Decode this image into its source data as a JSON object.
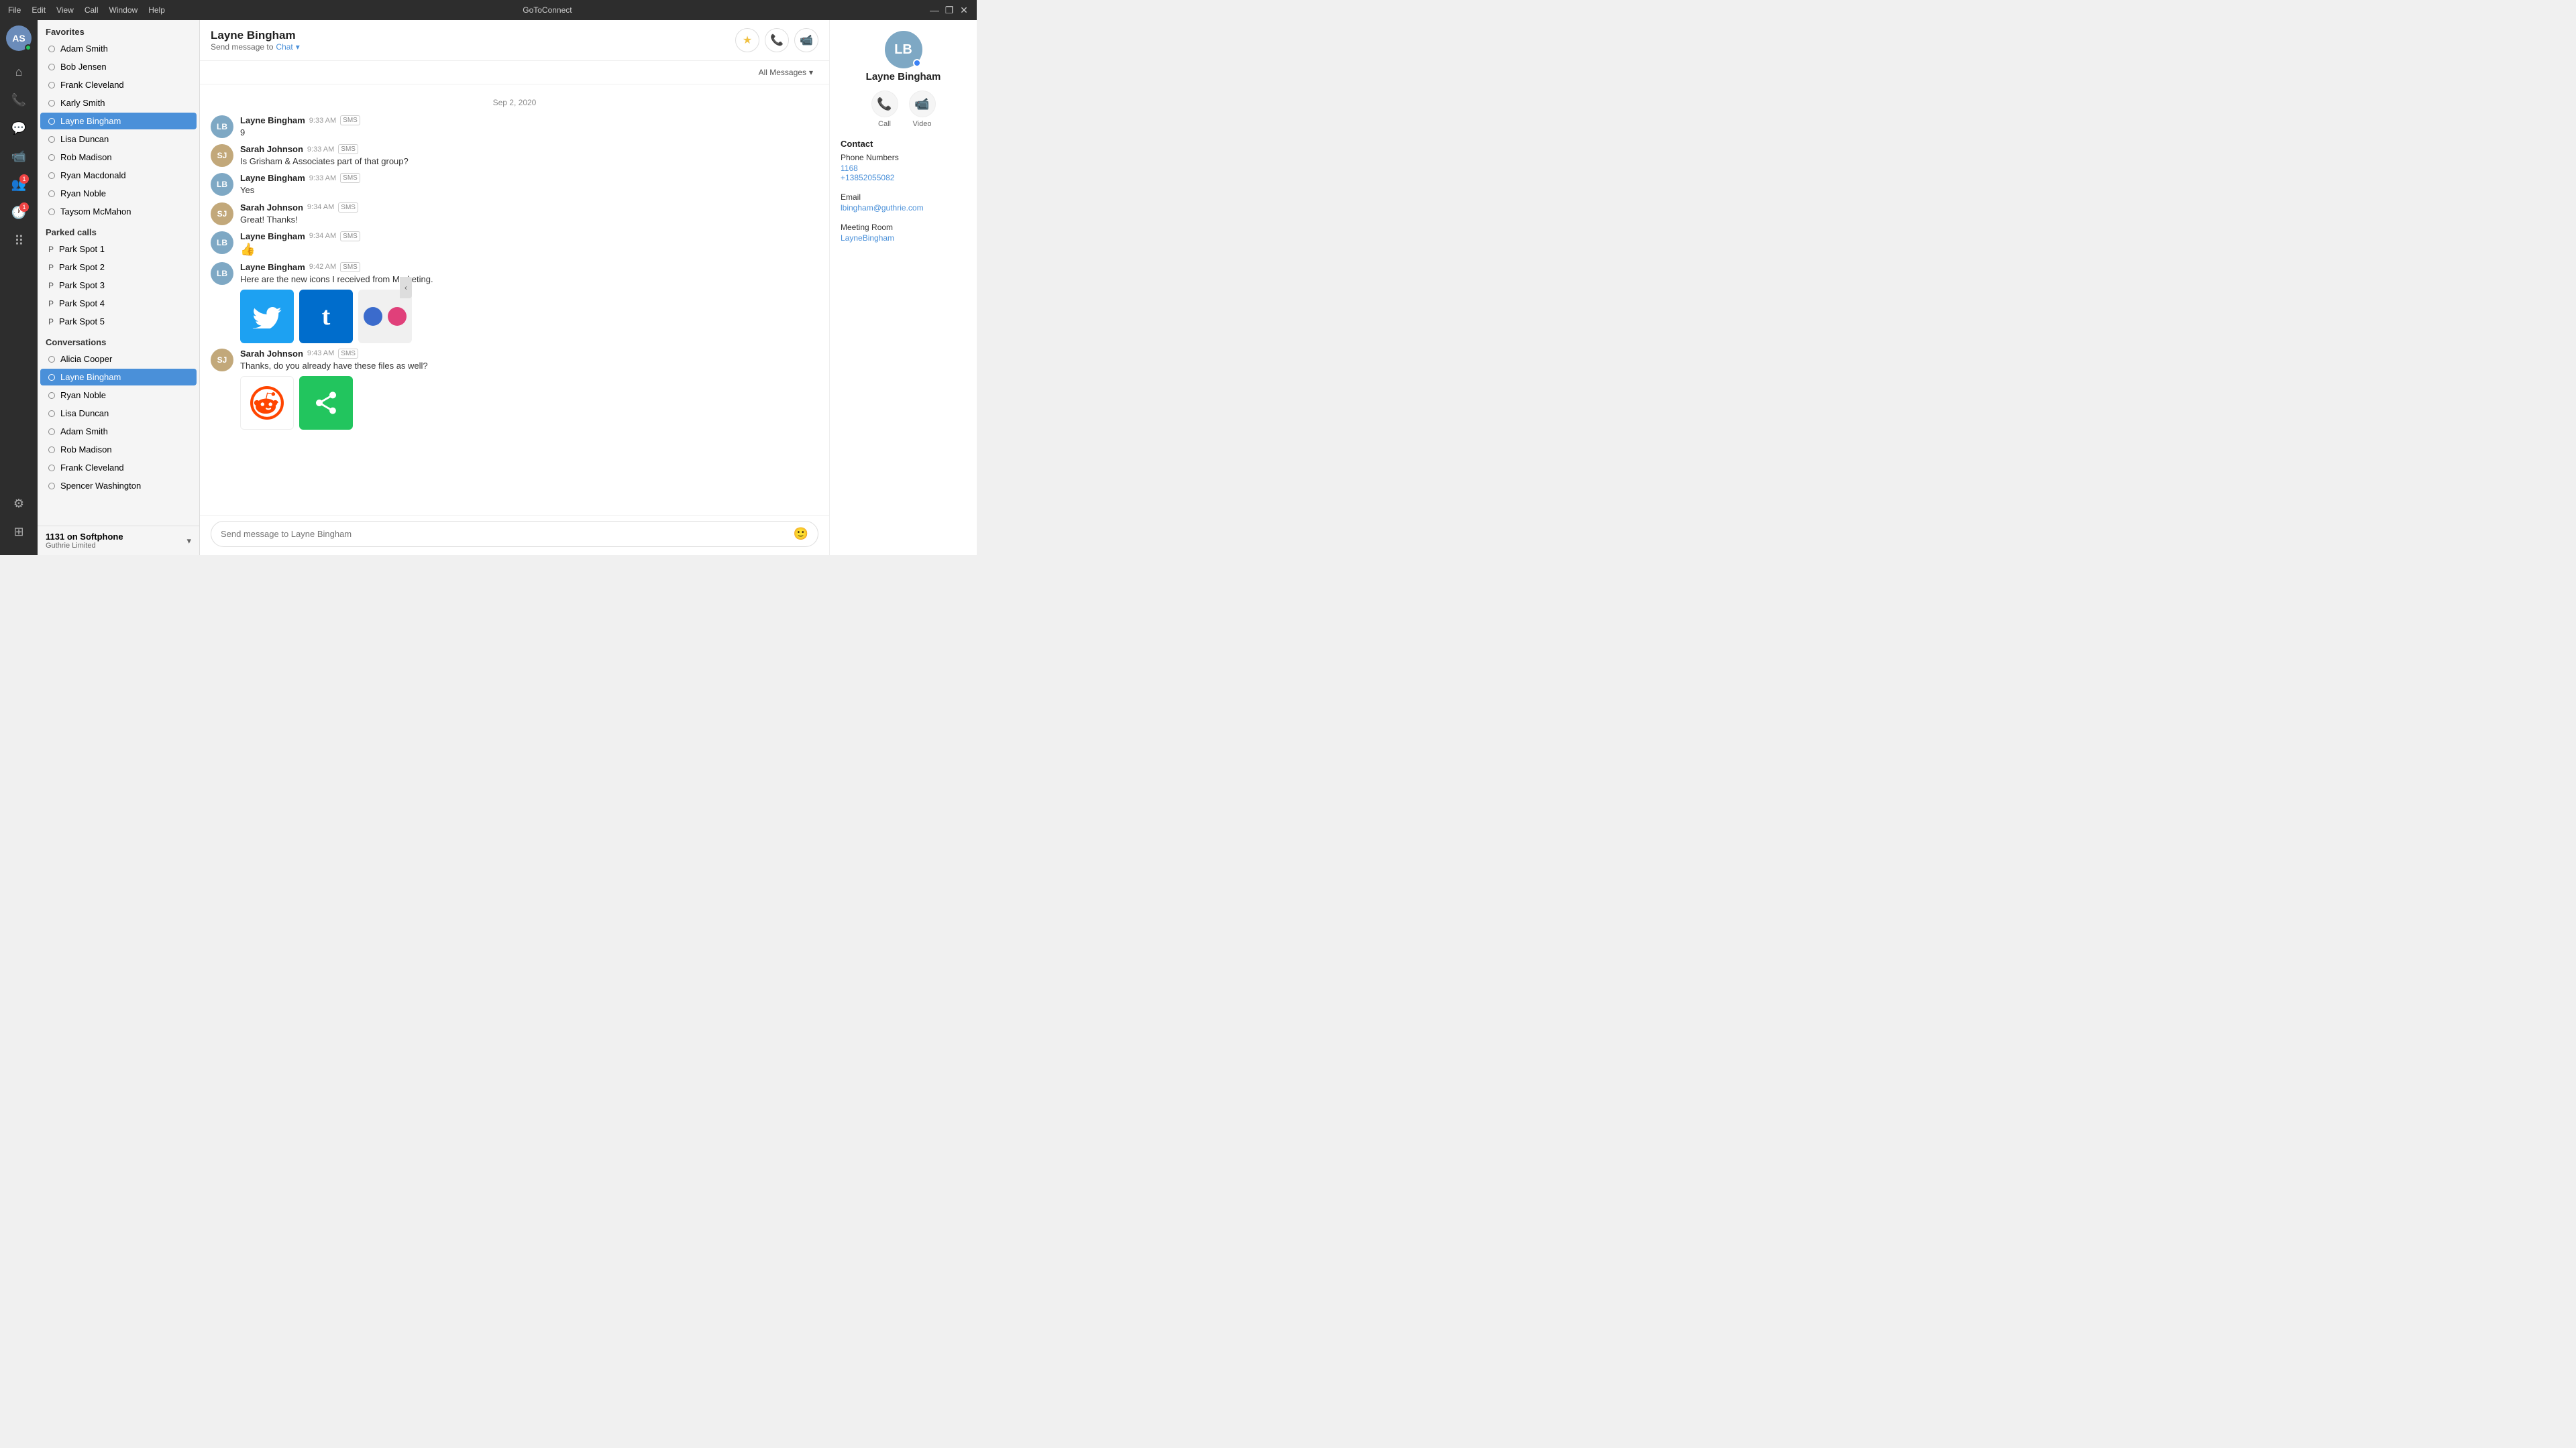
{
  "titlebar": {
    "menu_items": [
      "File",
      "Edit",
      "View",
      "Call",
      "Window",
      "Help"
    ],
    "app_title": "GoToConnect",
    "controls": [
      "—",
      "❐",
      "✕"
    ]
  },
  "iconsidebar": {
    "avatar_initials": "AS",
    "icons": [
      {
        "name": "home-icon",
        "symbol": "⌂",
        "active": false
      },
      {
        "name": "phone-icon",
        "symbol": "📞",
        "active": false
      },
      {
        "name": "chat-icon",
        "symbol": "💬",
        "active": true
      },
      {
        "name": "video-icon",
        "symbol": "📹",
        "active": false
      },
      {
        "name": "contacts-icon",
        "symbol": "👥",
        "active": false,
        "badge": "1"
      },
      {
        "name": "recents-icon",
        "symbol": "🕐",
        "active": false,
        "badge": "1"
      },
      {
        "name": "dialpad-icon",
        "symbol": "⠿",
        "active": false
      }
    ],
    "bottom_icons": [
      {
        "name": "settings-icon",
        "symbol": "⚙",
        "active": false
      },
      {
        "name": "apps-grid-icon",
        "symbol": "⊞",
        "active": false
      }
    ]
  },
  "leftpanel": {
    "favorites_label": "Favorites",
    "favorites": [
      {
        "name": "Adam Smith",
        "active": false
      },
      {
        "name": "Bob Jensen",
        "active": false
      },
      {
        "name": "Frank Cleveland",
        "active": false
      },
      {
        "name": "Karly Smith",
        "active": false
      },
      {
        "name": "Layne Bingham",
        "active": true
      },
      {
        "name": "Lisa Duncan",
        "active": false
      },
      {
        "name": "Rob Madison",
        "active": false
      },
      {
        "name": "Ryan Macdonald",
        "active": false
      },
      {
        "name": "Ryan Noble",
        "active": false
      },
      {
        "name": "Taysom McMahon",
        "active": false
      }
    ],
    "parked_label": "Parked calls",
    "parked": [
      {
        "name": "Park Spot 1"
      },
      {
        "name": "Park Spot 2"
      },
      {
        "name": "Park Spot 3"
      },
      {
        "name": "Park Spot 4"
      },
      {
        "name": "Park Spot 5"
      }
    ],
    "conversations_label": "Conversations",
    "conversations": [
      {
        "name": "Alicia Cooper",
        "active": false
      },
      {
        "name": "Layne Bingham",
        "active": true
      },
      {
        "name": "Ryan Noble",
        "active": false
      },
      {
        "name": "Lisa Duncan",
        "active": false
      },
      {
        "name": "Adam Smith",
        "active": false
      },
      {
        "name": "Rob Madison",
        "active": false
      },
      {
        "name": "Frank Cleveland",
        "active": false
      },
      {
        "name": "Spencer Washington",
        "active": false
      }
    ],
    "footer_line1": "1131 on Softphone",
    "footer_line2": "Guthrie Limited"
  },
  "chat": {
    "contact_name": "Layne Bingham",
    "send_message_to_label": "Send message to",
    "channel": "Chat",
    "filter_label": "All Messages",
    "date_divider": "Sep 2, 2020",
    "messages": [
      {
        "id": "msg1",
        "sender": "Layne Bingham",
        "avatar_type": "lb",
        "avatar_initials": "LB",
        "time": "9:33 AM",
        "sms": true,
        "text": "9"
      },
      {
        "id": "msg2",
        "sender": "Sarah Johnson",
        "avatar_type": "sarah",
        "avatar_initials": "SJ",
        "time": "9:33 AM",
        "sms": true,
        "text": "Is Grisham & Associates part of that group?"
      },
      {
        "id": "msg3",
        "sender": "Layne Bingham",
        "avatar_type": "lb",
        "avatar_initials": "LB",
        "time": "9:33 AM",
        "sms": true,
        "text": "Yes"
      },
      {
        "id": "msg4",
        "sender": "Sarah Johnson",
        "avatar_type": "sarah",
        "avatar_initials": "SJ",
        "time": "9:34 AM",
        "sms": true,
        "text": "Great! Thanks!"
      },
      {
        "id": "msg5",
        "sender": "Layne Bingham",
        "avatar_type": "lb",
        "avatar_initials": "LB",
        "time": "9:34 AM",
        "sms": true,
        "text": "👍",
        "emoji": true
      },
      {
        "id": "msg6",
        "sender": "Layne Bingham",
        "avatar_type": "lb",
        "avatar_initials": "LB",
        "time": "9:42 AM",
        "sms": true,
        "text": "Here are the new icons I received from Marketing.",
        "has_images": true,
        "images": [
          "twitter",
          "twitter2",
          "dots"
        ]
      },
      {
        "id": "msg7",
        "sender": "Sarah Johnson",
        "avatar_type": "sarah",
        "avatar_initials": "SJ",
        "time": "9:43 AM",
        "sms": true,
        "text": "Thanks, do you already have these files as well?",
        "has_images": true,
        "images": [
          "reddit",
          "share"
        ]
      }
    ],
    "input_placeholder": "Send message to Layne Bingham"
  },
  "rightpanel": {
    "avatar_initials": "LB",
    "contact_name": "Layne Bingham",
    "call_label": "Call",
    "video_label": "Video",
    "contact_section": "Contact",
    "phone_numbers_label": "Phone Numbers",
    "phone_numbers": [
      "1168",
      "+13852055082"
    ],
    "email_label": "Email",
    "email": "lbingham@guthrie.com",
    "meeting_room_label": "Meeting Room",
    "meeting_room": "LayneBingham"
  }
}
